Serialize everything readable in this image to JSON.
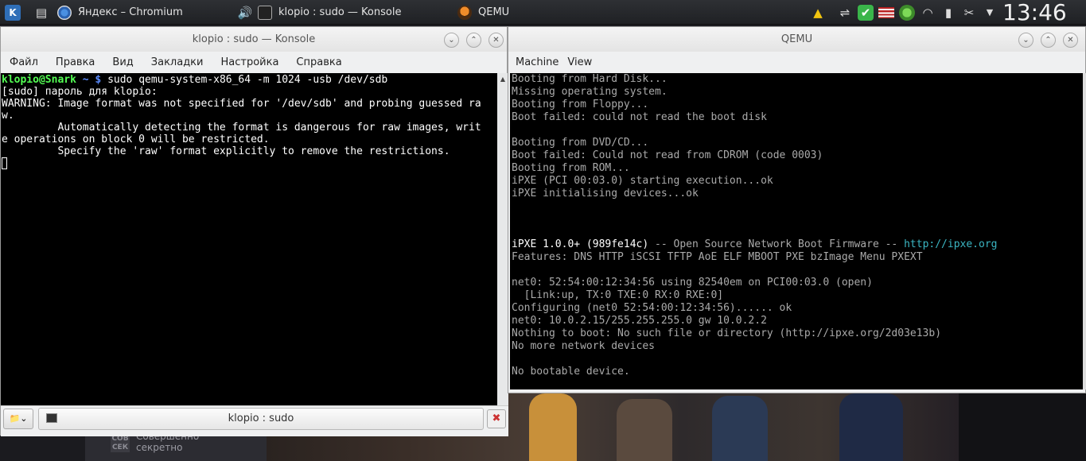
{
  "panel": {
    "tasks": [
      {
        "label": "Яндекс – Chromium"
      },
      {
        "label": "klopio : sudo — Konsole"
      },
      {
        "label": "QEMU"
      }
    ],
    "clock": "13:46"
  },
  "konsole": {
    "title": "klopio : sudo — Konsole",
    "menu": [
      "Файл",
      "Правка",
      "Вид",
      "Закладки",
      "Настройка",
      "Справка"
    ],
    "prompt_user": "klopio@Snark",
    "prompt_path": "~",
    "prompt_sign": "$",
    "command": "sudo qemu-system-x86_64 -m 1024 -usb /dev/sdb",
    "output": [
      "[sudo] пароль для klopio:",
      "WARNING: Image format was not specified for '/dev/sdb' and probing guessed ra",
      "w.",
      "         Automatically detecting the format is dangerous for raw images, writ",
      "e operations on block 0 will be restricted.",
      "         Specify the 'raw' format explicitly to remove the restrictions."
    ],
    "tab_label": "klopio : sudo"
  },
  "qemu": {
    "title": "QEMU",
    "menu": [
      "Machine",
      "View"
    ],
    "lines": [
      "Booting from Hard Disk...",
      "Missing operating system.",
      "Booting from Floppy...",
      "Boot failed: could not read the boot disk",
      "",
      "Booting from DVD/CD...",
      "Boot failed: Could not read from CDROM (code 0003)",
      "Booting from ROM...",
      "iPXE (PCI 00:03.0) starting execution...ok",
      "iPXE initialising devices...ok",
      "",
      "",
      "",
      "",
      "Features: DNS HTTP iSCSI TFTP AoE ELF MBOOT PXE bzImage Menu PXEXT",
      "",
      "net0: 52:54:00:12:34:56 using 82540em on PCI00:03.0 (open)",
      "  [Link:up, TX:0 TXE:0 RX:0 RXE:0]",
      "Configuring (net0 52:54:00:12:34:56)...... ok",
      "net0: 10.0.2.15/255.255.255.0 gw 10.0.2.2",
      "Nothing to boot: No such file or directory (http://ipxe.org/2d03e13b)",
      "No more network devices",
      "",
      "No bootable device."
    ],
    "ipxe_version": "iPXE 1.0.0+ (989fe14c)",
    "ipxe_tagline": " -- Open Source Network Boot Firmware -- ",
    "ipxe_url": "http://ipxe.org"
  },
  "wallpaper": {
    "logo": "СОВ СЕК",
    "caption": "Совершенно секретно"
  }
}
